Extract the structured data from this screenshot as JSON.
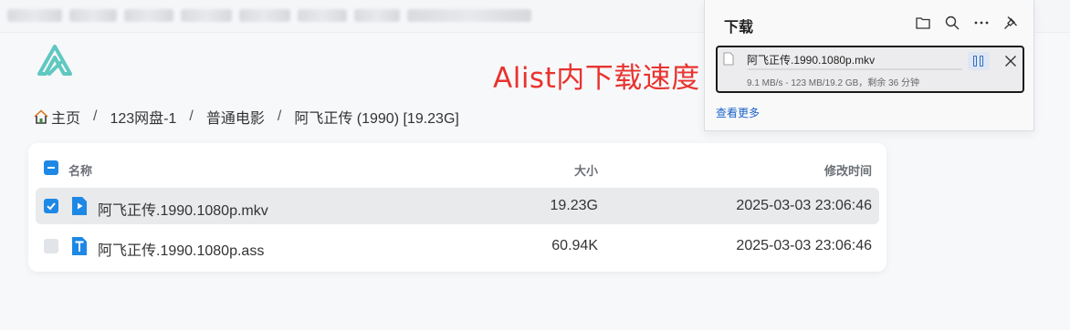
{
  "browser": {
    "tabs_blurred": 8
  },
  "annotation": {
    "text": "Alist内下载速度",
    "color": "#e8332f"
  },
  "breadcrumb": {
    "items": [
      "主页",
      "123网盘-1",
      "普通电影",
      "阿飞正传 (1990) [19.23G]"
    ],
    "separator": "/"
  },
  "table": {
    "headers": {
      "name": "名称",
      "size": "大小",
      "modified": "修改时间"
    },
    "rows": [
      {
        "name": "阿飞正传.1990.1080p.mkv",
        "size": "19.23G",
        "modified": "2025-03-03 23:06:46",
        "selected": true,
        "icon": "video-file-icon"
      },
      {
        "name": "阿飞正传.1990.1080p.ass",
        "size": "60.94K",
        "modified": "2025-03-03 23:06:46",
        "selected": false,
        "icon": "text-file-icon"
      }
    ]
  },
  "downloads": {
    "title": "下载",
    "item": {
      "filename": "阿飞正传.1990.1080p.mkv",
      "status": "9.1 MB/s - 123 MB/19.2 GB，剩余 36 分钟",
      "progress_fraction": 0.0064
    },
    "more_label": "查看更多"
  },
  "colors": {
    "accent": "#1e88e5",
    "link": "#1a62c8",
    "logo": "#5fc8c0"
  }
}
